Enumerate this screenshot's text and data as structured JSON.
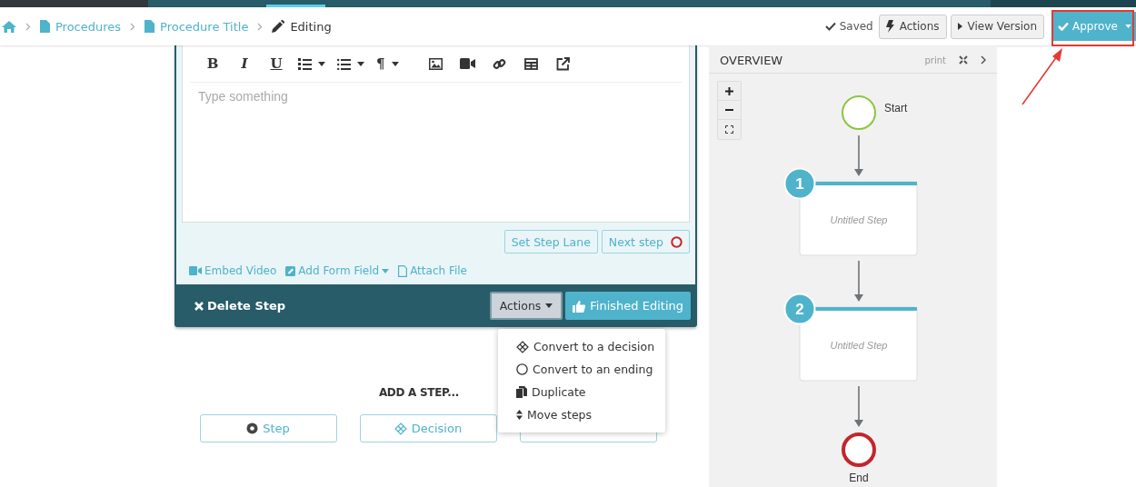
{
  "breadcrumb": [
    {
      "label": "Procedures",
      "kind": "link"
    },
    {
      "label": "Procedure Title",
      "kind": "link"
    },
    {
      "label": "Editing",
      "kind": "current"
    }
  ],
  "header": {
    "status": "Saved",
    "buttons": [
      {
        "label": "Actions",
        "kind": "actions"
      },
      {
        "label": "View Version",
        "kind": "view"
      },
      {
        "label": "Approve",
        "kind": "approve"
      }
    ]
  },
  "editor": {
    "toolbar": [
      {
        "kind": "bold",
        "glyph": "B"
      },
      {
        "kind": "italic",
        "glyph": "I"
      },
      {
        "kind": "underline",
        "glyph": "U"
      },
      {
        "kind": "ordered-list"
      },
      {
        "kind": "bullet-list"
      },
      {
        "kind": "paragraph",
        "glyph": "¶"
      },
      {
        "kind": "image"
      },
      {
        "kind": "video"
      },
      {
        "kind": "link"
      },
      {
        "kind": "table"
      },
      {
        "kind": "external"
      }
    ],
    "placeholder": "Type something",
    "step_buttons": [
      {
        "label": "Set Step Lane",
        "kind": "lane"
      },
      {
        "label": "Next step",
        "kind": "next"
      }
    ],
    "attachments": [
      {
        "label": "Embed Video",
        "kind": "video"
      },
      {
        "label": "Add Form Field",
        "kind": "form"
      },
      {
        "label": "Attach File",
        "kind": "file"
      }
    ]
  },
  "footer": {
    "delete": "Delete Step",
    "actions": {
      "label": "Actions",
      "expanded": true
    },
    "finish": "Finished Editing"
  },
  "actions_menu": [
    {
      "label": "Convert to a decision",
      "kind": "decision"
    },
    {
      "label": "Convert to an ending",
      "kind": "ending"
    },
    {
      "label": "Duplicate",
      "kind": "duplicate"
    },
    {
      "label": "Move steps",
      "kind": "move"
    }
  ],
  "add_step": {
    "title": "ADD A STEP...",
    "buttons": [
      {
        "label": "Step",
        "kind": "step"
      },
      {
        "label": "Decision",
        "kind": "decision"
      },
      {
        "kind": "end"
      }
    ]
  },
  "overview": {
    "title": "OVERVIEW",
    "print": "print",
    "nodes": [
      {
        "kind": "start",
        "label": "Start"
      },
      {
        "kind": "step",
        "number": "1",
        "title": "Untitled Step"
      },
      {
        "kind": "step",
        "number": "2",
        "title": "Untitled Step"
      },
      {
        "kind": "end",
        "label": "End"
      }
    ]
  }
}
